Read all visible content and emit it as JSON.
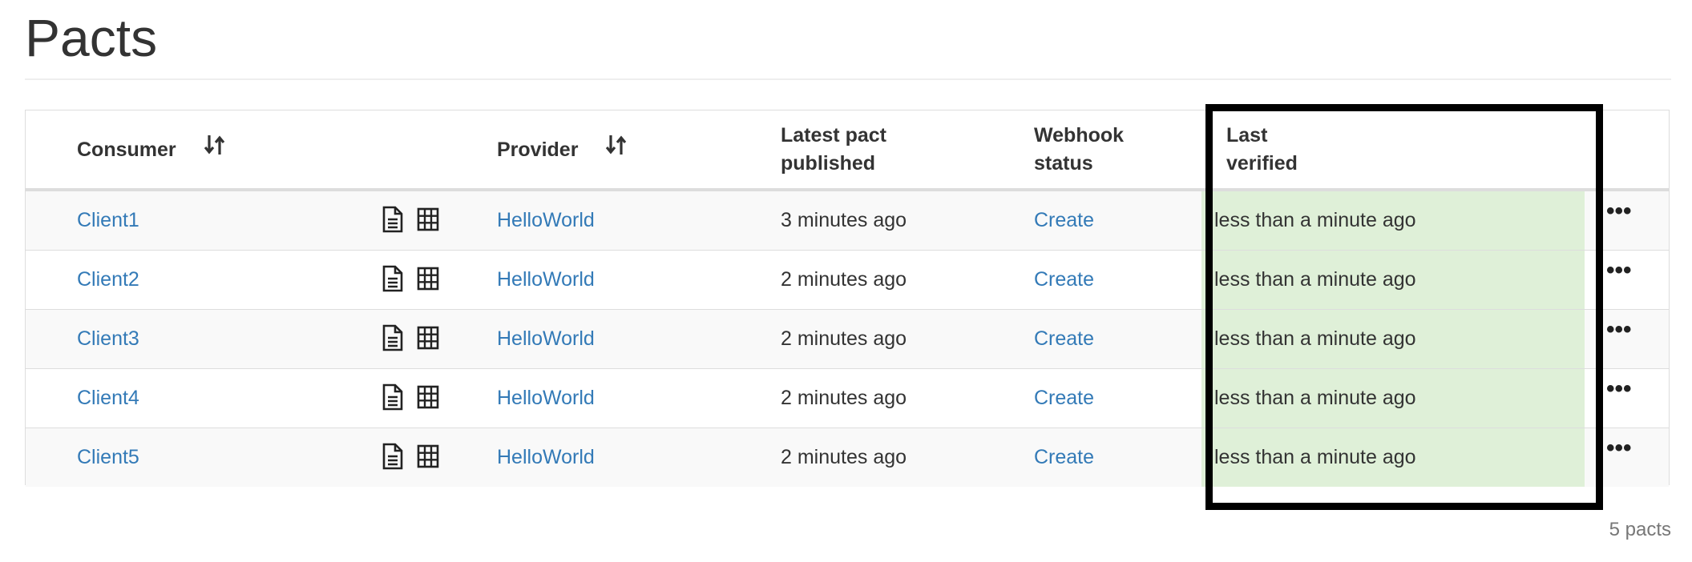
{
  "page": {
    "title": "Pacts",
    "footer_count": "5 pacts"
  },
  "table": {
    "headers": {
      "consumer": "Consumer",
      "provider": "Provider",
      "latest_pact_line1": "Latest pact",
      "latest_pact_line2": "published",
      "webhook_line1": "Webhook",
      "webhook_line2": "status",
      "last_verified_line1": "Last",
      "last_verified_line2": "verified"
    },
    "rows": [
      {
        "consumer": "Client1",
        "provider": "HelloWorld",
        "latest_pact": "3 minutes ago",
        "webhook": "Create",
        "last_verified": "less than a minute ago"
      },
      {
        "consumer": "Client2",
        "provider": "HelloWorld",
        "latest_pact": "2 minutes ago",
        "webhook": "Create",
        "last_verified": "less than a minute ago"
      },
      {
        "consumer": "Client3",
        "provider": "HelloWorld",
        "latest_pact": "2 minutes ago",
        "webhook": "Create",
        "last_verified": "less than a minute ago"
      },
      {
        "consumer": "Client4",
        "provider": "HelloWorld",
        "latest_pact": "2 minutes ago",
        "webhook": "Create",
        "last_verified": "less than a minute ago"
      },
      {
        "consumer": "Client5",
        "provider": "HelloWorld",
        "latest_pact": "2 minutes ago",
        "webhook": "Create",
        "last_verified": "less than a minute ago"
      }
    ],
    "row_icons": [
      "document-icon",
      "grid-icon"
    ],
    "row_menu_icon": "ellipsis-icon",
    "sort_icon": "sort-icon"
  },
  "colors": {
    "link": "#337ab7",
    "verified_success_bg": "#dff0d8",
    "highlight_border": "#000000",
    "row_stripe": "#f9f9f9"
  }
}
